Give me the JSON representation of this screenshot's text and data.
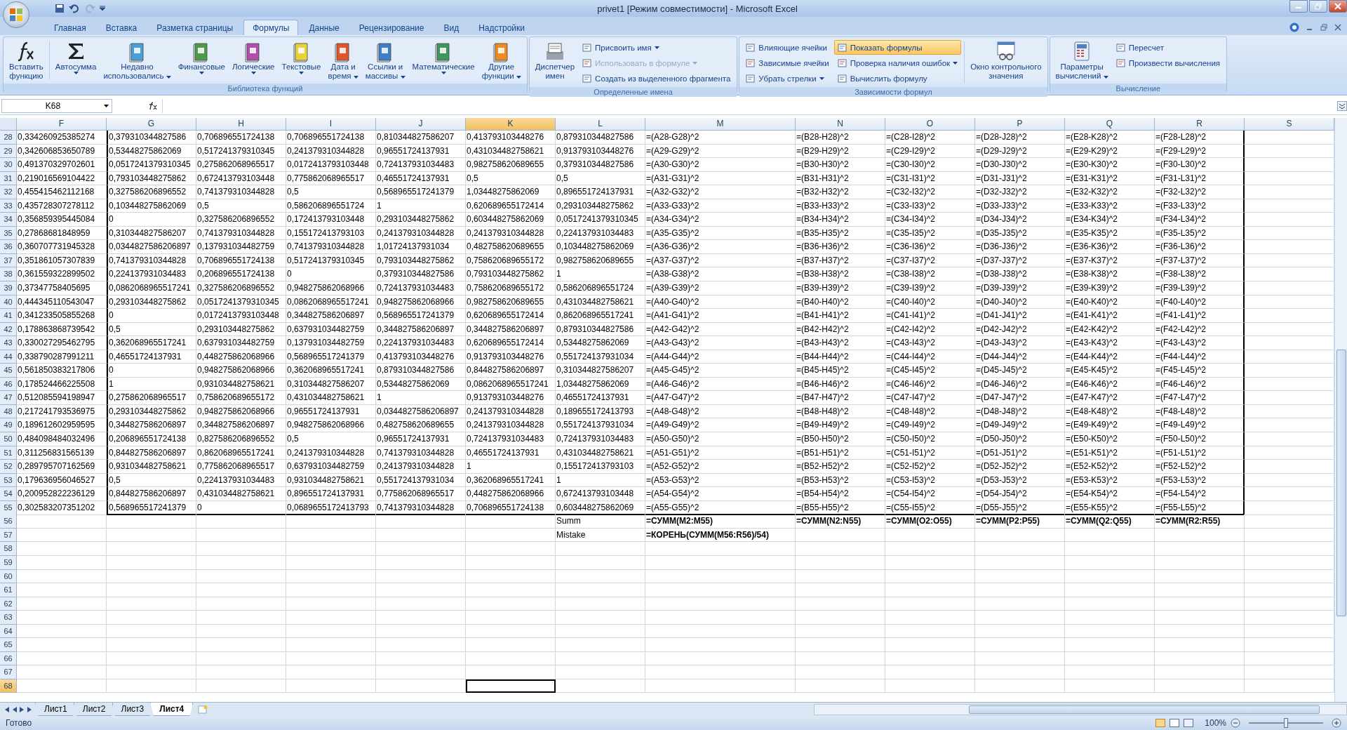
{
  "window": {
    "title": "privet1  [Режим совместимости] - Microsoft Excel"
  },
  "ribbon_tabs": [
    {
      "label": "Главная",
      "selected": false
    },
    {
      "label": "Вставка",
      "selected": false
    },
    {
      "label": "Разметка страницы",
      "selected": false
    },
    {
      "label": "Формулы",
      "selected": true
    },
    {
      "label": "Данные",
      "selected": false
    },
    {
      "label": "Рецензирование",
      "selected": false
    },
    {
      "label": "Вид",
      "selected": false
    },
    {
      "label": "Надстройки",
      "selected": false
    }
  ],
  "ribbon_groups": [
    {
      "title": "Библиотека функций",
      "items": [
        {
          "kind": "fx",
          "lines": [
            "Вставить",
            "функцию"
          ],
          "dropdown": false
        },
        {
          "kind": "sigma",
          "lines": [
            "Автосумма"
          ],
          "dropdown": true
        },
        {
          "kind": "book",
          "color": "#4a9fd8",
          "lines": [
            "Недавно",
            "использовались"
          ],
          "dropdown": true
        },
        {
          "kind": "book",
          "color": "#4f9a4a",
          "lines": [
            "Финансовые"
          ],
          "dropdown": true
        },
        {
          "kind": "book",
          "color": "#b04fa8",
          "lines": [
            "Логические"
          ],
          "dropdown": true
        },
        {
          "kind": "book",
          "color": "#e8d23a",
          "lines": [
            "Текстовые"
          ],
          "dropdown": true
        },
        {
          "kind": "book",
          "color": "#e0562a",
          "lines": [
            "Дата и",
            "время"
          ],
          "dropdown": true
        },
        {
          "kind": "book",
          "color": "#3f7fc8",
          "lines": [
            "Ссылки и",
            "массивы"
          ],
          "dropdown": true
        },
        {
          "kind": "book",
          "color": "#3e9560",
          "lines": [
            "Математические"
          ],
          "dropdown": true
        },
        {
          "kind": "book",
          "color": "#f08a22",
          "lines": [
            "Другие",
            "функции"
          ],
          "dropdown": true
        }
      ]
    },
    {
      "title": "Определенные имена",
      "items": [
        {
          "kind": "names",
          "lines": [
            "Диспетчер",
            "имен"
          ],
          "dropdown": false
        },
        {
          "kind": "stack",
          "entries": [
            {
              "label": "Присвоить имя",
              "dropdown": true,
              "disabled": false,
              "on": false
            },
            {
              "label": "Использовать в формуле",
              "dropdown": true,
              "disabled": true,
              "on": false
            },
            {
              "label": "Создать из выделенного фрагмента",
              "dropdown": false,
              "disabled": false,
              "on": false
            }
          ]
        }
      ]
    },
    {
      "title": "Зависимости формул",
      "items": [
        {
          "kind": "stack",
          "entries": [
            {
              "label": "Влияющие ячейки",
              "dropdown": false,
              "disabled": false,
              "on": false
            },
            {
              "label": "Зависимые ячейки",
              "dropdown": false,
              "disabled": false,
              "on": false
            },
            {
              "label": "Убрать стрелки",
              "dropdown": true,
              "disabled": false,
              "on": false
            }
          ]
        },
        {
          "kind": "stack",
          "entries": [
            {
              "label": "Показать формулы",
              "dropdown": false,
              "disabled": false,
              "on": true
            },
            {
              "label": "Проверка наличия ошибок",
              "dropdown": true,
              "disabled": false,
              "on": false
            },
            {
              "label": "Вычислить формулу",
              "dropdown": false,
              "disabled": false,
              "on": false
            }
          ]
        },
        {
          "kind": "watch",
          "lines": [
            "Окно контрольного",
            "значения"
          ],
          "dropdown": false
        }
      ]
    },
    {
      "title": "Вычисление",
      "items": [
        {
          "kind": "calc",
          "lines": [
            "Параметры",
            "вычислений"
          ],
          "dropdown": true
        },
        {
          "kind": "stack",
          "entries": [
            {
              "label": "Пересчет",
              "dropdown": false,
              "disabled": false,
              "on": false
            },
            {
              "label": "Произвести вычисления",
              "dropdown": false,
              "disabled": false,
              "on": false
            }
          ]
        }
      ]
    }
  ],
  "name_box": "K68",
  "columns": [
    {
      "label": "F",
      "selected": false
    },
    {
      "label": "G",
      "selected": false
    },
    {
      "label": "H",
      "selected": false
    },
    {
      "label": "I",
      "selected": false
    },
    {
      "label": "J",
      "selected": false
    },
    {
      "label": "K",
      "selected": true
    },
    {
      "label": "L",
      "selected": false
    },
    {
      "label": "M",
      "selected": false
    },
    {
      "label": "N",
      "selected": false
    },
    {
      "label": "O",
      "selected": false
    },
    {
      "label": "P",
      "selected": false
    },
    {
      "label": "Q",
      "selected": false
    },
    {
      "label": "R",
      "selected": false
    },
    {
      "label": "S",
      "selected": false
    }
  ],
  "rows": [
    {
      "number": "28",
      "kind": "data",
      "selected": false,
      "cells": [
        "0,334260925385274",
        "0,379310344827586",
        "0,706896551724138",
        "0,706896551724138",
        "0,810344827586207",
        "0,413793103448276",
        "0,879310344827586",
        "=(A28-G28)^2",
        "=(B28-H28)^2",
        "=(C28-I28)^2",
        "=(D28-J28)^2",
        "=(E28-K28)^2",
        "=(F28-L28)^2"
      ]
    },
    {
      "number": "29",
      "kind": "data",
      "selected": false,
      "cells": [
        "0,342606853650789",
        "0,53448275862069",
        "0,517241379310345",
        "0,241379310344828",
        "0,96551724137931",
        "0,431034482758621",
        "0,913793103448276",
        "=(A29-G29)^2",
        "=(B29-H29)^2",
        "=(C29-I29)^2",
        "=(D29-J29)^2",
        "=(E29-K29)^2",
        "=(F29-L29)^2"
      ]
    },
    {
      "number": "30",
      "kind": "data",
      "selected": false,
      "cells": [
        "0,491370329702601",
        "0,0517241379310345",
        "0,275862068965517",
        "0,0172413793103448",
        "0,724137931034483",
        "0,982758620689655",
        "0,379310344827586",
        "=(A30-G30)^2",
        "=(B30-H30)^2",
        "=(C30-I30)^2",
        "=(D30-J30)^2",
        "=(E30-K30)^2",
        "=(F30-L30)^2"
      ]
    },
    {
      "number": "31",
      "kind": "data",
      "selected": false,
      "cells": [
        "0,219016569104422",
        "0,793103448275862",
        "0,672413793103448",
        "0,775862068965517",
        "0,46551724137931",
        "0,5",
        "0,5",
        "=(A31-G31)^2",
        "=(B31-H31)^2",
        "=(C31-I31)^2",
        "=(D31-J31)^2",
        "=(E31-K31)^2",
        "=(F31-L31)^2"
      ]
    },
    {
      "number": "32",
      "kind": "data",
      "selected": false,
      "cells": [
        "0,455415462112168",
        "0,327586206896552",
        "0,741379310344828",
        "0,5",
        "0,568965517241379",
        "1,03448275862069",
        "0,896551724137931",
        "=(A32-G32)^2",
        "=(B32-H32)^2",
        "=(C32-I32)^2",
        "=(D32-J32)^2",
        "=(E32-K32)^2",
        "=(F32-L32)^2"
      ]
    },
    {
      "number": "33",
      "kind": "data",
      "selected": false,
      "cells": [
        "0,435728307278112",
        "0,103448275862069",
        "0,5",
        "0,586206896551724",
        "1",
        "0,620689655172414",
        "0,293103448275862",
        "=(A33-G33)^2",
        "=(B33-H33)^2",
        "=(C33-I33)^2",
        "=(D33-J33)^2",
        "=(E33-K33)^2",
        "=(F33-L33)^2"
      ]
    },
    {
      "number": "34",
      "kind": "data",
      "selected": false,
      "cells": [
        "0,356859395445084",
        "0",
        "0,327586206896552",
        "0,172413793103448",
        "0,293103448275862",
        "0,603448275862069",
        "0,0517241379310345",
        "=(A34-G34)^2",
        "=(B34-H34)^2",
        "=(C34-I34)^2",
        "=(D34-J34)^2",
        "=(E34-K34)^2",
        "=(F34-L34)^2"
      ]
    },
    {
      "number": "35",
      "kind": "data",
      "selected": false,
      "cells": [
        "0,27868681848959",
        "0,310344827586207",
        "0,741379310344828",
        "0,155172413793103",
        "0,241379310344828",
        "0,241379310344828",
        "0,224137931034483",
        "=(A35-G35)^2",
        "=(B35-H35)^2",
        "=(C35-I35)^2",
        "=(D35-J35)^2",
        "=(E35-K35)^2",
        "=(F35-L35)^2"
      ]
    },
    {
      "number": "36",
      "kind": "data",
      "selected": false,
      "cells": [
        "0,360707731945328",
        "0,0344827586206897",
        "0,137931034482759",
        "0,741379310344828",
        "1,01724137931034",
        "0,482758620689655",
        "0,103448275862069",
        "=(A36-G36)^2",
        "=(B36-H36)^2",
        "=(C36-I36)^2",
        "=(D36-J36)^2",
        "=(E36-K36)^2",
        "=(F36-L36)^2"
      ]
    },
    {
      "number": "37",
      "kind": "data",
      "selected": false,
      "cells": [
        "0,351861057307839",
        "0,741379310344828",
        "0,706896551724138",
        "0,517241379310345",
        "0,793103448275862",
        "0,758620689655172",
        "0,982758620689655",
        "=(A37-G37)^2",
        "=(B37-H37)^2",
        "=(C37-I37)^2",
        "=(D37-J37)^2",
        "=(E37-K37)^2",
        "=(F37-L37)^2"
      ]
    },
    {
      "number": "38",
      "kind": "data",
      "selected": false,
      "cells": [
        "0,361559322899502",
        "0,224137931034483",
        "0,206896551724138",
        "0",
        "0,379310344827586",
        "0,793103448275862",
        "1",
        "=(A38-G38)^2",
        "=(B38-H38)^2",
        "=(C38-I38)^2",
        "=(D38-J38)^2",
        "=(E38-K38)^2",
        "=(F38-L38)^2"
      ]
    },
    {
      "number": "39",
      "kind": "data",
      "selected": false,
      "cells": [
        "0,37347758405695",
        "0,0862068965517241",
        "0,327586206896552",
        "0,948275862068966",
        "0,724137931034483",
        "0,758620689655172",
        "0,586206896551724",
        "=(A39-G39)^2",
        "=(B39-H39)^2",
        "=(C39-I39)^2",
        "=(D39-J39)^2",
        "=(E39-K39)^2",
        "=(F39-L39)^2"
      ]
    },
    {
      "number": "40",
      "kind": "data",
      "selected": false,
      "cells": [
        "0,444345110543047",
        "0,293103448275862",
        "0,0517241379310345",
        "0,0862068965517241",
        "0,948275862068966",
        "0,982758620689655",
        "0,431034482758621",
        "=(A40-G40)^2",
        "=(B40-H40)^2",
        "=(C40-I40)^2",
        "=(D40-J40)^2",
        "=(E40-K40)^2",
        "=(F40-L40)^2"
      ]
    },
    {
      "number": "41",
      "kind": "data",
      "selected": false,
      "cells": [
        "0,341233505855268",
        "0",
        "0,0172413793103448",
        "0,344827586206897",
        "0,568965517241379",
        "0,620689655172414",
        "0,862068965517241",
        "=(A41-G41)^2",
        "=(B41-H41)^2",
        "=(C41-I41)^2",
        "=(D41-J41)^2",
        "=(E41-K41)^2",
        "=(F41-L41)^2"
      ]
    },
    {
      "number": "42",
      "kind": "data",
      "selected": false,
      "cells": [
        "0,178863868739542",
        "0,5",
        "0,293103448275862",
        "0,637931034482759",
        "0,344827586206897",
        "0,344827586206897",
        "0,879310344827586",
        "=(A42-G42)^2",
        "=(B42-H42)^2",
        "=(C42-I42)^2",
        "=(D42-J42)^2",
        "=(E42-K42)^2",
        "=(F42-L42)^2"
      ]
    },
    {
      "number": "43",
      "kind": "data",
      "selected": false,
      "cells": [
        "0,330027295462795",
        "0,362068965517241",
        "0,637931034482759",
        "0,137931034482759",
        "0,224137931034483",
        "0,620689655172414",
        "0,53448275862069",
        "=(A43-G43)^2",
        "=(B43-H43)^2",
        "=(C43-I43)^2",
        "=(D43-J43)^2",
        "=(E43-K43)^2",
        "=(F43-L43)^2"
      ]
    },
    {
      "number": "44",
      "kind": "data",
      "selected": false,
      "cells": [
        "0,338790287991211",
        "0,46551724137931",
        "0,448275862068966",
        "0,568965517241379",
        "0,413793103448276",
        "0,913793103448276",
        "0,551724137931034",
        "=(A44-G44)^2",
        "=(B44-H44)^2",
        "=(C44-I44)^2",
        "=(D44-J44)^2",
        "=(E44-K44)^2",
        "=(F44-L44)^2"
      ]
    },
    {
      "number": "45",
      "kind": "data",
      "selected": false,
      "cells": [
        "0,561850383217806",
        "0",
        "0,948275862068966",
        "0,362068965517241",
        "0,879310344827586",
        "0,844827586206897",
        "0,310344827586207",
        "=(A45-G45)^2",
        "=(B45-H45)^2",
        "=(C45-I45)^2",
        "=(D45-J45)^2",
        "=(E45-K45)^2",
        "=(F45-L45)^2"
      ]
    },
    {
      "number": "46",
      "kind": "data",
      "selected": false,
      "cells": [
        "0,178524466225508",
        "1",
        "0,931034482758621",
        "0,310344827586207",
        "0,53448275862069",
        "0,0862068965517241",
        "1,03448275862069",
        "=(A46-G46)^2",
        "=(B46-H46)^2",
        "=(C46-I46)^2",
        "=(D46-J46)^2",
        "=(E46-K46)^2",
        "=(F46-L46)^2"
      ]
    },
    {
      "number": "47",
      "kind": "data",
      "selected": false,
      "cells": [
        "0,512085594198947",
        "0,275862068965517",
        "0,758620689655172",
        "0,431034482758621",
        "1",
        "0,913793103448276",
        "0,46551724137931",
        "=(A47-G47)^2",
        "=(B47-H47)^2",
        "=(C47-I47)^2",
        "=(D47-J47)^2",
        "=(E47-K47)^2",
        "=(F47-L47)^2"
      ]
    },
    {
      "number": "48",
      "kind": "data",
      "selected": false,
      "cells": [
        "0,217241793536975",
        "0,293103448275862",
        "0,948275862068966",
        "0,96551724137931",
        "0,0344827586206897",
        "0,241379310344828",
        "0,189655172413793",
        "=(A48-G48)^2",
        "=(B48-H48)^2",
        "=(C48-I48)^2",
        "=(D48-J48)^2",
        "=(E48-K48)^2",
        "=(F48-L48)^2"
      ]
    },
    {
      "number": "49",
      "kind": "data",
      "selected": false,
      "cells": [
        "0,189612602959595",
        "0,344827586206897",
        "0,344827586206897",
        "0,948275862068966",
        "0,482758620689655",
        "0,241379310344828",
        "0,551724137931034",
        "=(A49-G49)^2",
        "=(B49-H49)^2",
        "=(C49-I49)^2",
        "=(D49-J49)^2",
        "=(E49-K49)^2",
        "=(F49-L49)^2"
      ]
    },
    {
      "number": "50",
      "kind": "data",
      "selected": false,
      "cells": [
        "0,484098484032496",
        "0,206896551724138",
        "0,827586206896552",
        "0,5",
        "0,96551724137931",
        "0,724137931034483",
        "0,724137931034483",
        "=(A50-G50)^2",
        "=(B50-H50)^2",
        "=(C50-I50)^2",
        "=(D50-J50)^2",
        "=(E50-K50)^2",
        "=(F50-L50)^2"
      ]
    },
    {
      "number": "51",
      "kind": "data",
      "selected": false,
      "cells": [
        "0,311256831565139",
        "0,844827586206897",
        "0,862068965517241",
        "0,241379310344828",
        "0,741379310344828",
        "0,46551724137931",
        "0,431034482758621",
        "=(A51-G51)^2",
        "=(B51-H51)^2",
        "=(C51-I51)^2",
        "=(D51-J51)^2",
        "=(E51-K51)^2",
        "=(F51-L51)^2"
      ]
    },
    {
      "number": "52",
      "kind": "data",
      "selected": false,
      "cells": [
        "0,289795707162569",
        "0,931034482758621",
        "0,775862068965517",
        "0,637931034482759",
        "0,241379310344828",
        "1",
        "0,155172413793103",
        "=(A52-G52)^2",
        "=(B52-H52)^2",
        "=(C52-I52)^2",
        "=(D52-J52)^2",
        "=(E52-K52)^2",
        "=(F52-L52)^2"
      ]
    },
    {
      "number": "53",
      "kind": "data",
      "selected": false,
      "cells": [
        "0,179636956046527",
        "0,5",
        "0,224137931034483",
        "0,931034482758621",
        "0,551724137931034",
        "0,362068965517241",
        "1",
        "=(A53-G53)^2",
        "=(B53-H53)^2",
        "=(C53-I53)^2",
        "=(D53-J53)^2",
        "=(E53-K53)^2",
        "=(F53-L53)^2"
      ]
    },
    {
      "number": "54",
      "kind": "data",
      "selected": false,
      "cells": [
        "0,200952822236129",
        "0,844827586206897",
        "0,431034482758621",
        "0,896551724137931",
        "0,775862068965517",
        "0,448275862068966",
        "0,672413793103448",
        "=(A54-G54)^2",
        "=(B54-H54)^2",
        "=(C54-I54)^2",
        "=(D54-J54)^2",
        "=(E54-K54)^2",
        "=(F54-L54)^2"
      ]
    },
    {
      "number": "55",
      "kind": "data",
      "selected": false,
      "cells": [
        "0,302583207351202",
        "0,568965517241379",
        "0",
        "0,0689655172413793",
        "0,741379310344828",
        "0,706896551724138",
        "0,603448275862069",
        "=(A55-G55)^2",
        "=(B55-H55)^2",
        "=(C55-I55)^2",
        "=(D55-J55)^2",
        "=(E55-K55)^2",
        "=(F55-L55)^2"
      ]
    },
    {
      "number": "56",
      "kind": "summary",
      "selected": false,
      "cells": [
        null,
        null,
        null,
        null,
        null,
        null,
        {
          "text": "Summ",
          "bold": false
        },
        {
          "text": "=СУММ(M2:M55)",
          "bold": true
        },
        {
          "text": "=СУММ(N2:N55)",
          "bold": true
        },
        {
          "text": "=СУММ(O2:O55)",
          "bold": true
        },
        {
          "text": "=СУММ(P2:P55)",
          "bold": true
        },
        {
          "text": "=СУММ(Q2:Q55)",
          "bold": true
        },
        {
          "text": "=СУММ(R2:R55)",
          "bold": true
        }
      ]
    },
    {
      "number": "57",
      "kind": "summary",
      "selected": false,
      "cells": [
        null,
        null,
        null,
        null,
        null,
        null,
        {
          "text": "Mistake",
          "bold": false
        },
        {
          "text": "=КОРЕНЬ(СУММ(M56:R56)/54)",
          "bold": true
        }
      ]
    },
    {
      "number": "58",
      "kind": "blank",
      "selected": false
    },
    {
      "number": "59",
      "kind": "blank",
      "selected": false
    },
    {
      "number": "60",
      "kind": "blank",
      "selected": false
    },
    {
      "number": "61",
      "kind": "blank",
      "selected": false
    },
    {
      "number": "62",
      "kind": "blank",
      "selected": false
    },
    {
      "number": "63",
      "kind": "blank",
      "selected": false
    },
    {
      "number": "64",
      "kind": "blank",
      "selected": false
    },
    {
      "number": "65",
      "kind": "blank",
      "selected": false
    },
    {
      "number": "66",
      "kind": "blank",
      "selected": false
    },
    {
      "number": "67",
      "kind": "blank",
      "selected": false
    },
    {
      "number": "68",
      "kind": "blank",
      "selected": true
    }
  ],
  "sheet_tabs": [
    {
      "label": "Лист1",
      "selected": false
    },
    {
      "label": "Лист2",
      "selected": false
    },
    {
      "label": "Лист3",
      "selected": false
    },
    {
      "label": "Лист4",
      "selected": true
    }
  ],
  "status_bar": {
    "status": "Готово",
    "zoom": "100%",
    "zoom_level": {
      "level": 0.5
    }
  }
}
